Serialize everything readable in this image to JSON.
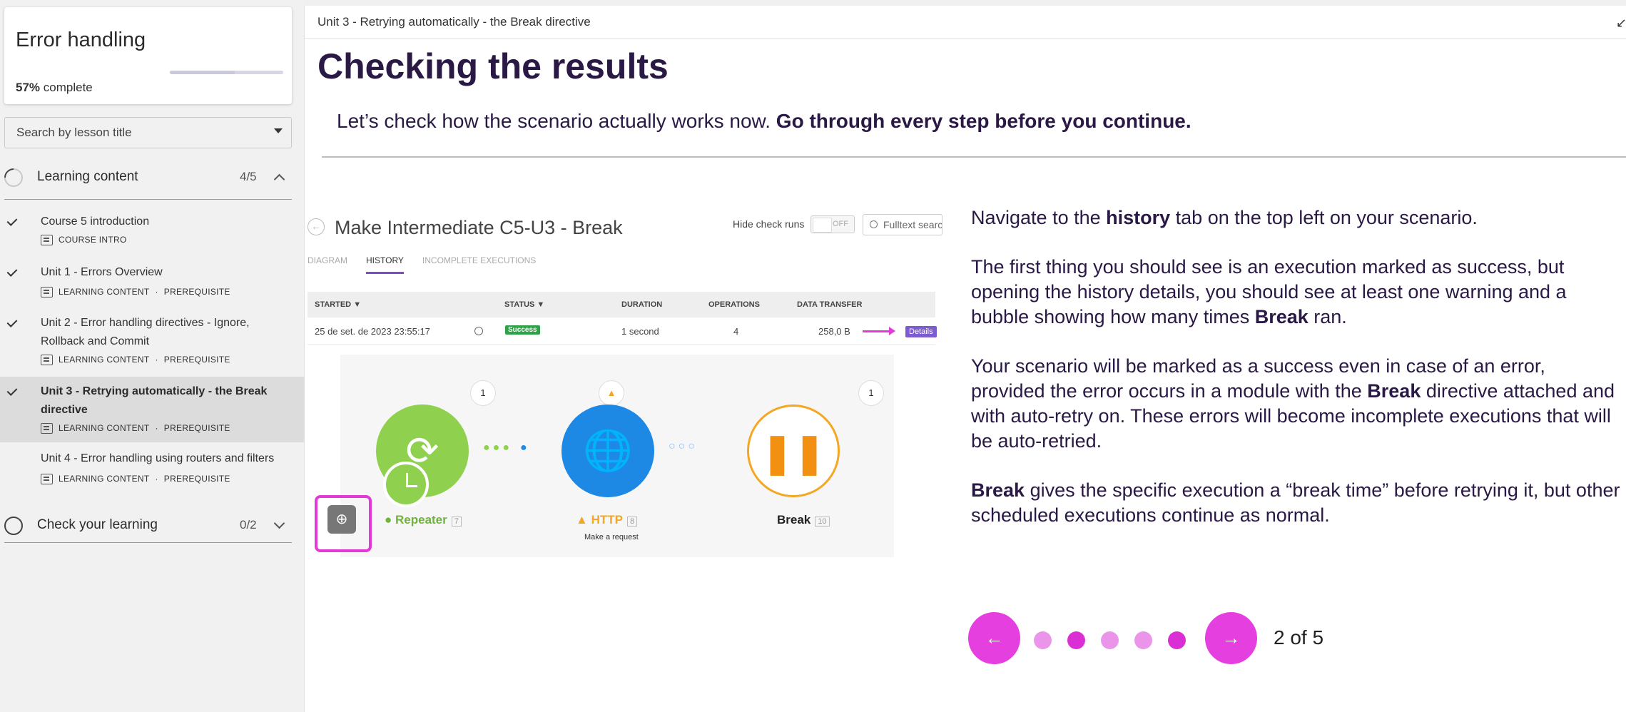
{
  "sidebar": {
    "course_title": "Error handling",
    "progress_percent": "57%",
    "progress_label": "complete",
    "progress_fraction": 0.57,
    "search_placeholder": "Search by lesson title",
    "sections": [
      {
        "label": "Learning content",
        "count": "4/5"
      },
      {
        "label": "Check your learning",
        "count": "0/2"
      }
    ],
    "lessons": [
      {
        "title": "Course 5 introduction",
        "meta": [
          "COURSE INTRO"
        ],
        "completed": true
      },
      {
        "title": "Unit 1 - Errors Overview",
        "meta": [
          "LEARNING CONTENT",
          "PREREQUISITE"
        ],
        "completed": true
      },
      {
        "title": "Unit 2 - Error handling directives - Ignore, Rollback and Commit",
        "meta": [
          "LEARNING CONTENT",
          "PREREQUISITE"
        ],
        "completed": true
      },
      {
        "title": "Unit 3 - Retrying automatically - the Break directive",
        "meta": [
          "LEARNING CONTENT",
          "PREREQUISITE"
        ],
        "completed": true,
        "active": true
      },
      {
        "title": "Unit 4 - Error handling using routers and filters",
        "meta": [
          "LEARNING CONTENT",
          "PREREQUISITE"
        ],
        "completed": false
      }
    ],
    "meta_separator": "·"
  },
  "main": {
    "breadcrumb": "Unit 3 - Retrying automatically - the Break directive",
    "collapse_glyph": "↙",
    "title": "Checking the results",
    "intro_plain": "Let’s check how the scenario actually works now.",
    "intro_bold": "Go through every step before you continue."
  },
  "screenshot": {
    "title": "Make Intermediate C5-U3 - Break",
    "hide_check_runs": "Hide check runs",
    "toggle_state": "OFF",
    "search_placeholder": "Fulltext search",
    "tabs": [
      "DIAGRAM",
      "HISTORY",
      "INCOMPLETE EXECUTIONS"
    ],
    "columns": [
      "STARTED",
      "STATUS",
      "DURATION",
      "OPERATIONS",
      "DATA TRANSFER"
    ],
    "row": {
      "started": "25 de set. de 2023 23:55:17",
      "status": "Success",
      "duration": "1 second",
      "operations": "4",
      "data_transfer": "258,0 B",
      "details": "Details"
    },
    "nodes": [
      {
        "label": "Repeater",
        "num": "7",
        "bubble": "1"
      },
      {
        "label": "HTTP",
        "num": "8",
        "bubble": "▲",
        "sub": "Make a request"
      },
      {
        "label": "Break",
        "num": "10",
        "bubble": "1"
      }
    ]
  },
  "explanation": {
    "p1_a": "Navigate to the ",
    "p1_b": "history",
    "p1_c": " tab on the top left on your scenario.",
    "p2_a": "The first thing you should see is an execution marked as success, but opening the history details, you should see at least one warning and a bubble showing how many times ",
    "p2_b": "Break",
    "p2_c": " ran.",
    "p3_a": "Your scenario will be marked as a success even in case of an error, provided the error occurs in a module with the ",
    "p3_b": "Break",
    "p3_c": " directive attached and with auto-retry on. These errors will become incomplete executions that will be auto-retried.",
    "p4_a": "Break",
    "p4_b": " gives the specific execution a “break time” before retrying it, but other scheduled executions continue as normal."
  },
  "pager": {
    "prev_glyph": "←",
    "next_glyph": "→",
    "current": 2,
    "total": 5,
    "label": "2 of 5"
  },
  "colors": {
    "accent": "#e63fe0",
    "title": "#2a1845",
    "success": "#2fa148"
  }
}
